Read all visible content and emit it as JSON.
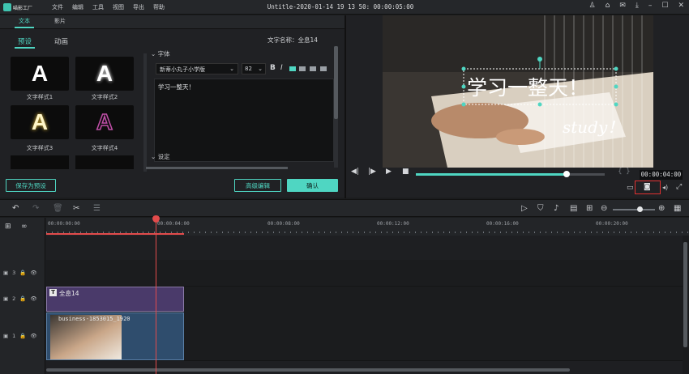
{
  "menubar": {
    "app_name": "喵影工厂",
    "items": [
      "文件",
      "编辑",
      "工具",
      "视图",
      "导出",
      "帮助"
    ],
    "title": "Untitle-2020-01-14 19 13 50: 00:00:05:00"
  },
  "left": {
    "top_tabs": [
      "文本",
      "影片"
    ],
    "sub_tabs": [
      "预设",
      "动画"
    ],
    "text_name": "文字名称：全息14",
    "styles": [
      {
        "glyph": "A",
        "label": "文字样式1"
      },
      {
        "glyph": "A",
        "label": "文字样式2"
      },
      {
        "glyph": "A",
        "label": "文字样式3"
      },
      {
        "glyph": "A",
        "label": "文字样式4"
      }
    ],
    "font_section": "字体",
    "font_name": "新蒂小丸子小学版",
    "font_size": "82",
    "bold": "B",
    "italic": "I",
    "text_value": "学习一整天！",
    "settings_section": "设定",
    "save_preset": "保存为预设",
    "advanced_edit": "高级编辑",
    "confirm": "确认"
  },
  "preview": {
    "overlay_text": "学习一整天！",
    "overlay_text2": "study！",
    "timecode": "00:00:04:00",
    "progress": 0.8
  },
  "timeline": {
    "ruler": [
      "00:00:00:00",
      "00:00:04:00",
      "00:00:08:00",
      "00:00:12:00",
      "00:00:16:00",
      "00:00:20:00"
    ],
    "tracks": [
      {
        "num": "3"
      },
      {
        "num": "2"
      },
      {
        "num": "1"
      }
    ],
    "text_clip": "全息14",
    "video_clip": "business-1853015_1920",
    "clip_icon": "T"
  },
  "colors": {
    "accent": "#4fd6c2",
    "playhead": "#e24b4b",
    "text_clip": "#4a3a6a",
    "video_clip": "#2f4d6d"
  }
}
